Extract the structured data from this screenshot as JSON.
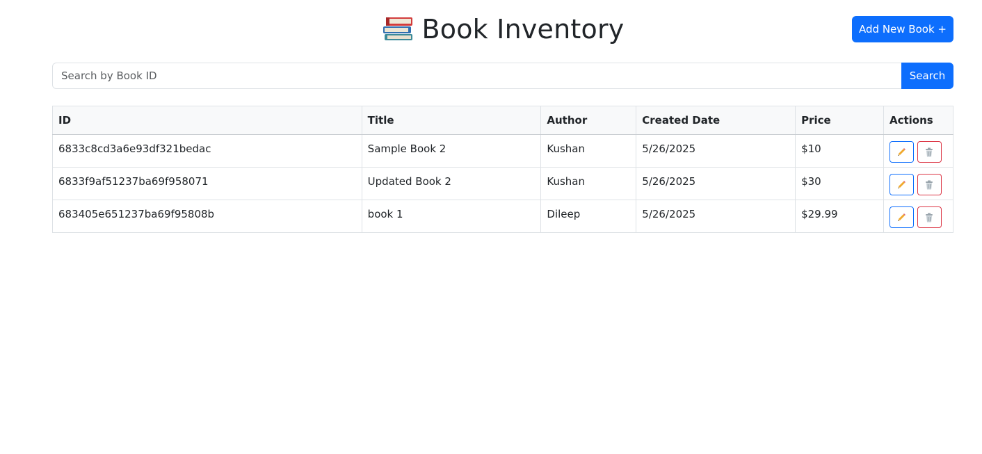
{
  "header": {
    "title": "Book Inventory",
    "title_icon": "books-icon",
    "add_button_label": "Add New Book +"
  },
  "search": {
    "placeholder": "Search by Book ID",
    "value": "",
    "button_label": "Search"
  },
  "table": {
    "columns": [
      "ID",
      "Title",
      "Author",
      "Created Date",
      "Price",
      "Actions"
    ],
    "rows": [
      {
        "id": "6833c8cd3a6e93df321bedac",
        "title": "Sample Book 2",
        "author": "Kushan",
        "created": "5/26/2025",
        "price": "$10"
      },
      {
        "id": "6833f9af51237ba69f958071",
        "title": "Updated Book 2",
        "author": "Kushan",
        "created": "5/26/2025",
        "price": "$30"
      },
      {
        "id": "683405e651237ba69f95808b",
        "title": "book 1",
        "author": "Dileep",
        "created": "5/26/2025",
        "price": "$29.99"
      }
    ],
    "actions": {
      "edit_icon": "pencil-icon",
      "delete_icon": "trash-icon"
    }
  },
  "colors": {
    "primary": "#0d6efd",
    "danger": "#dc3545",
    "header_bg": "#f8f9fa",
    "border": "#dee2e6"
  }
}
